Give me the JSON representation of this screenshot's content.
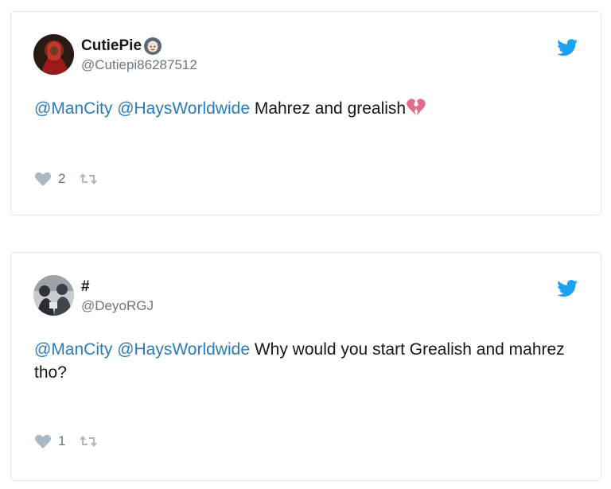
{
  "tweets": [
    {
      "display_name": "CutiePie",
      "handle": "@Cutiepi86287512",
      "mention1": "@ManCity",
      "mention2": "@HaysWorldwide",
      "text": " Mahrez and grealish",
      "like_count": "2"
    },
    {
      "display_name": "#",
      "handle": "@DeyoRGJ",
      "mention1": "@ManCity",
      "mention2": "@HaysWorldwide",
      "text": " Why would you start Grealish and mahrez tho?",
      "like_count": "1"
    }
  ],
  "icons": {
    "brand": "twitter-bird-icon",
    "like": "heart-icon",
    "retweet": "retweet-icon",
    "emoji": "woman-with-headscarf-emoji",
    "broken_heart": "broken-heart-emoji"
  },
  "colors": {
    "mention": "#2b7bb9",
    "twitter_blue": "#1da1f2",
    "muted": "#657786",
    "border": "#e1e8ed"
  }
}
